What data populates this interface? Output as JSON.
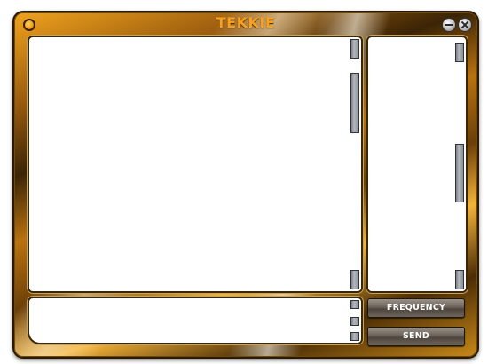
{
  "window": {
    "title": "TEKKIE"
  },
  "icons": {
    "menu": "menu-orb-icon",
    "minimize": "minimize-icon",
    "close": "close-icon"
  },
  "buttons": {
    "frequency_label": "FREQUENCY",
    "send_label": "SEND"
  },
  "colors": {
    "title": "#f7a11f",
    "frame_gold": "#f1a31d",
    "frame_dark": "#3b2406",
    "button_gray": "#6b625a"
  }
}
